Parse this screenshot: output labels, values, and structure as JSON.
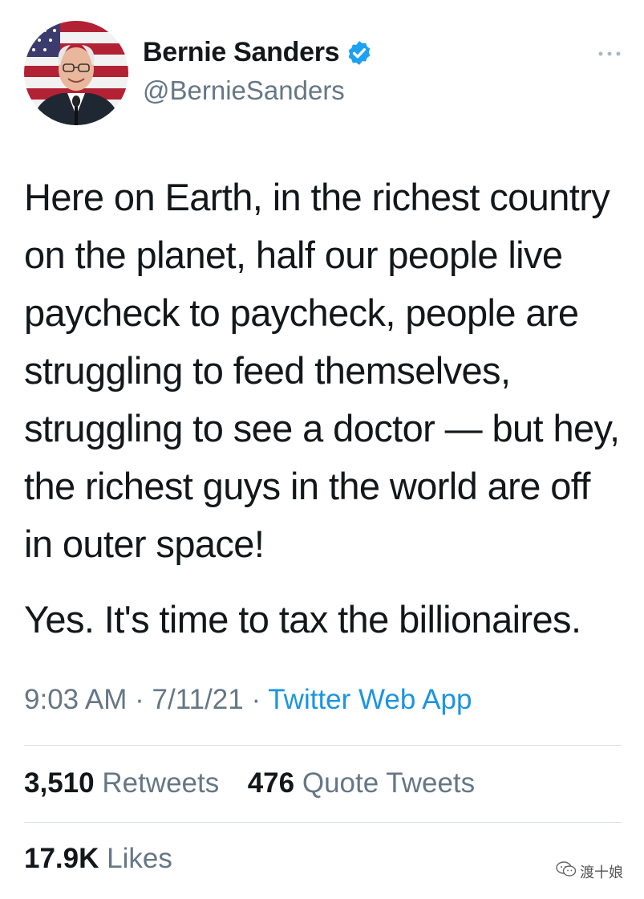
{
  "profile": {
    "display_name": "Bernie Sanders",
    "handle": "@BernieSanders",
    "verified": true
  },
  "menu_icon": "more-horizontal-icon",
  "tweet": {
    "paragraphs": [
      "Here on Earth, in the richest country on the planet, half our people live paycheck to paycheck, people are struggling to feed themselves, struggling to see a doctor — but hey, the richest guys in the world are off in outer space!",
      "Yes. It's time to tax the billionaires."
    ]
  },
  "meta": {
    "time": "9:03 AM",
    "separator": "·",
    "date": "7/11/21",
    "source": "Twitter Web App"
  },
  "stats": {
    "retweets_count": "3,510",
    "retweets_label": "Retweets",
    "quote_count": "476",
    "quote_label": "Quote Tweets",
    "likes_count": "17.9K",
    "likes_label": "Likes"
  },
  "watermark": {
    "text": "渡十娘"
  },
  "colors": {
    "text": "#14171a",
    "secondary": "#657786",
    "link": "#1b95e0",
    "verified": "#1da1f2"
  }
}
